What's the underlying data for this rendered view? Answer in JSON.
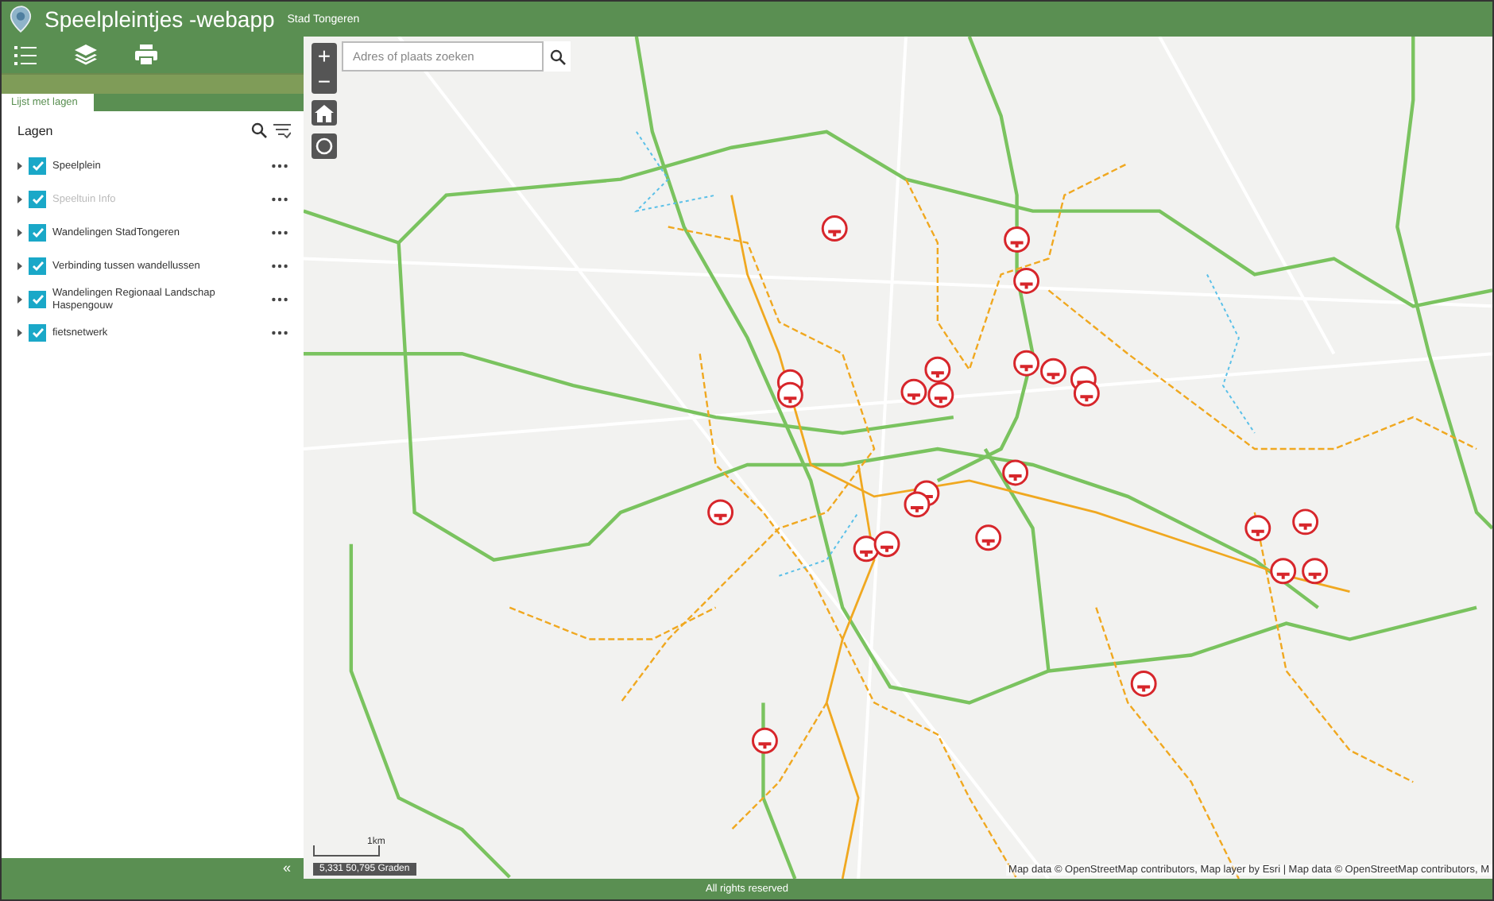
{
  "header": {
    "title": "Speelpleintjes -webapp",
    "subtitle": "Stad Tongeren"
  },
  "panel": {
    "tab": "Lijst met lagen",
    "heading": "Lagen",
    "collapse": "«",
    "layers": [
      {
        "name": "Speelplein",
        "checked": true,
        "disabled": false
      },
      {
        "name": "Speeltuin Info",
        "checked": true,
        "disabled": true
      },
      {
        "name": "Wandelingen StadTongeren",
        "checked": true,
        "disabled": false
      },
      {
        "name": "Verbinding tussen wandellussen",
        "checked": true,
        "disabled": false
      },
      {
        "name": "Wandelingen Regionaal Landschap Haspengouw",
        "checked": true,
        "disabled": false
      },
      {
        "name": "fietsnetwerk",
        "checked": true,
        "disabled": false
      }
    ]
  },
  "map": {
    "zoom_in": "+",
    "zoom_out": "−",
    "search": {
      "placeholder": "Adres of plaats zoeken"
    },
    "scale": "1km",
    "coordinates": "5,331 50,795 Graden",
    "attribution": "Map data © OpenStreetMap contributors, Map layer by Esri | Map data © OpenStreetMap contributors, M"
  },
  "footer": "All rights reserved"
}
